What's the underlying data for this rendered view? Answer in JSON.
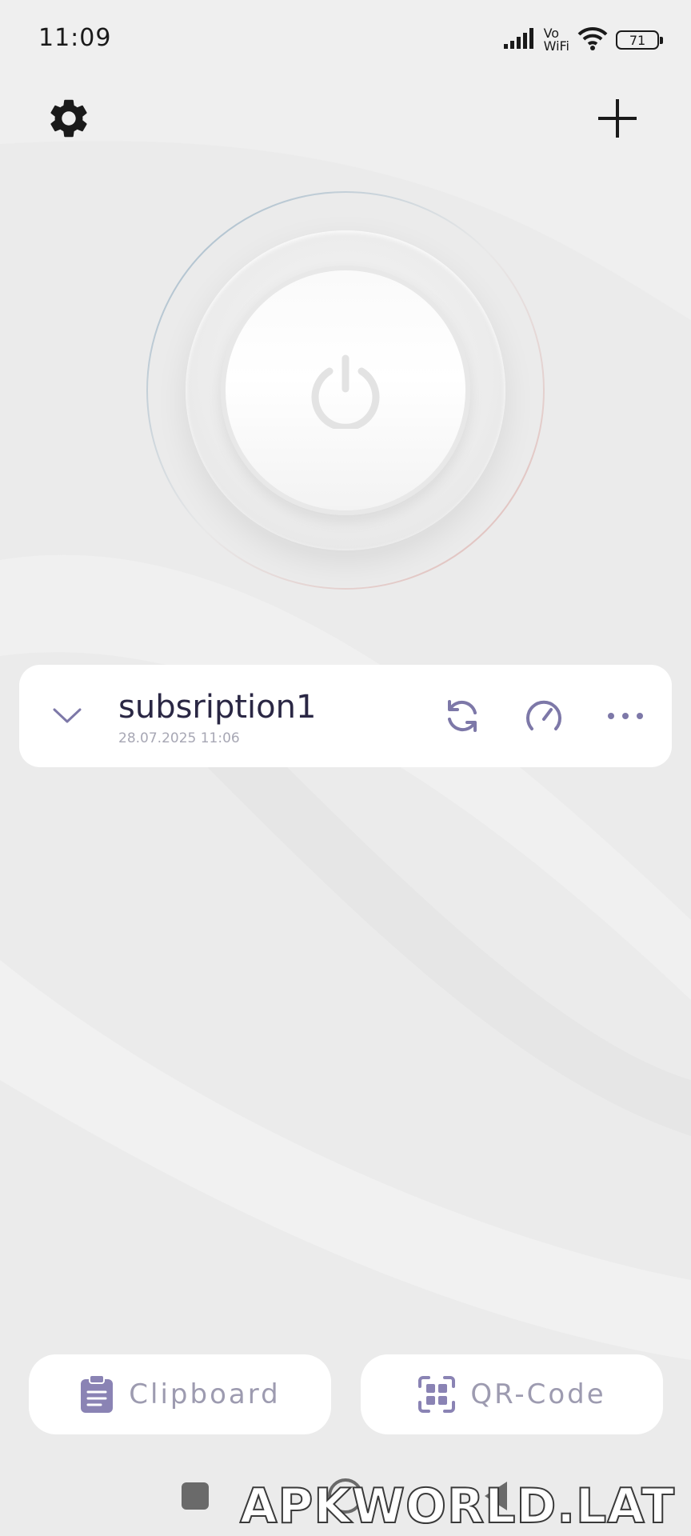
{
  "status_bar": {
    "time": "11:09",
    "vowifi_top": "Vo",
    "vowifi_bottom": "WiFi",
    "battery_level": "71",
    "icons": [
      "signal-bars-icon",
      "vowifi-icon",
      "wifi-icon",
      "battery-icon"
    ]
  },
  "toolbar": {
    "settings_icon": "gear-icon",
    "add_icon": "plus-icon"
  },
  "power": {
    "icon": "power-icon",
    "ring_colors": [
      "#9fb7c8",
      "#e0b8b4"
    ]
  },
  "subscription": {
    "name": "subsription1",
    "updated": "28.07.2025 11:06",
    "icons": [
      "chevron-down-icon",
      "refresh-icon",
      "speedometer-icon",
      "more-icon"
    ]
  },
  "bottom_actions": {
    "clipboard_label": "Clipboard",
    "qrcode_label": "QR-Code"
  },
  "watermark": "APKWORLD.LAT",
  "colors": {
    "background": "#ebebeb",
    "card": "#ffffff",
    "accent": "#7d78a8",
    "title_text": "#2a2744",
    "muted_text": "#a7a7b4"
  }
}
